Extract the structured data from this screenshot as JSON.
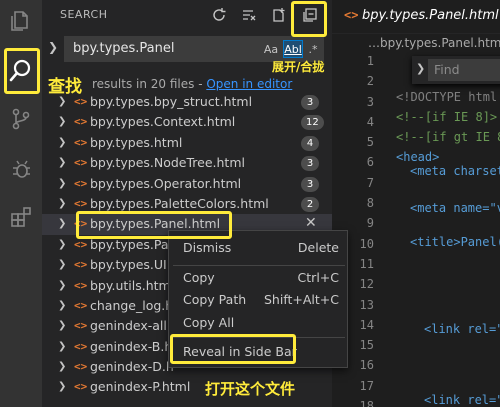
{
  "search": {
    "title": "SEARCH",
    "query": "bpy.types.Panel",
    "match_case_label": "Aa",
    "whole_word_label": "Abl",
    "regex_label": ".*",
    "results_text": "results in 20 files - ",
    "open_in_editor": "Open in editor"
  },
  "files": [
    {
      "name": "bpy.types.bpy_struct.html",
      "count": "3"
    },
    {
      "name": "bpy.types.Context.html",
      "count": "12"
    },
    {
      "name": "bpy.types.html",
      "count": "4"
    },
    {
      "name": "bpy.types.NodeTree.html",
      "count": "3"
    },
    {
      "name": "bpy.types.Operator.html",
      "count": "3"
    },
    {
      "name": "bpy.types.PaletteColors.html",
      "count": "2"
    },
    {
      "name": "bpy.types.Panel.html",
      "count": ""
    },
    {
      "name": "bpy.types.Pa",
      "count": ""
    },
    {
      "name": "bpy.types.UI",
      "count": ""
    },
    {
      "name": "bpy.utils.htm",
      "count": ""
    },
    {
      "name": "change_log.h",
      "count": ""
    },
    {
      "name": "genindex-all",
      "count": ""
    },
    {
      "name": "genindex-B.h",
      "count": ""
    },
    {
      "name": "genindex-D.h",
      "count": ""
    },
    {
      "name": "genindex-P.html",
      "count": ""
    }
  ],
  "editor": {
    "tab_title": "bpy.types.Panel.html",
    "breadcrumb": "…bpy.types.Panel.html",
    "find_placeholder": "Find",
    "line_numbers": [
      "1",
      "2",
      "3",
      "4",
      "5",
      "6",
      "7",
      "8",
      "9",
      "10",
      "11",
      "12",
      "13",
      "14",
      "15",
      "16",
      "17",
      "18",
      "19",
      "20"
    ],
    "code_lines": [
      {
        "text": "<!DOCTYPE html",
        "color": "#808080"
      },
      {
        "text": "<!--[if IE 8]>",
        "color": "#6a9955"
      },
      {
        "text": "<!--[if gt IE 8",
        "color": "#6a9955"
      },
      {
        "text": "<head>",
        "color": "#569cd6"
      },
      {
        "text": "<meta charset",
        "color": "#569cd6"
      },
      {
        "text": "<meta name=\"v",
        "color": "#569cd6"
      },
      {
        "text": "<title>Panel(",
        "color": "#569cd6"
      },
      {
        "text": "<link rel=\"",
        "color": "#569cd6"
      },
      {
        "text": "<link rel=\"",
        "color": "#569cd6"
      }
    ]
  },
  "context_menu": {
    "dismiss": "Dismiss",
    "delete": "Delete",
    "copy": "Copy",
    "copy_key": "Ctrl+C",
    "copy_path": "Copy Path",
    "copy_path_key": "Shift+Alt+C",
    "copy_all": "Copy All",
    "reveal": "Reveal in Side Bar"
  },
  "annotations": {
    "search_label": "查找",
    "expand_collapse_label": "展开/合拢",
    "open_file_label": "打开这个文件"
  },
  "colors": {
    "highlight": "#ffeb3b",
    "link": "#3794ff",
    "html_file_icon": "#e37933"
  }
}
